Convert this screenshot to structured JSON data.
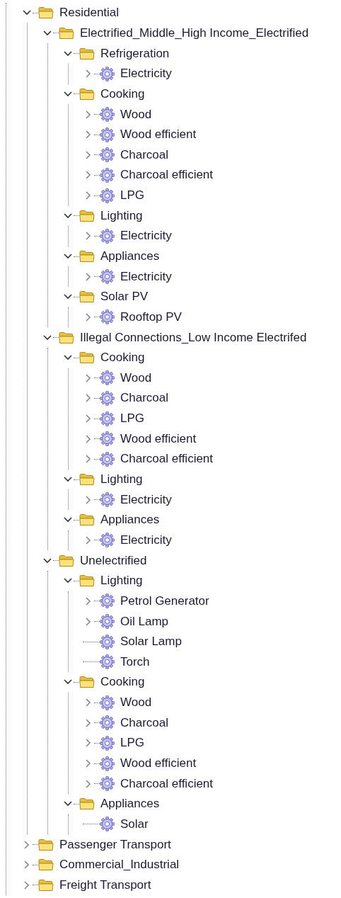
{
  "tree": [
    {
      "label": "Residential",
      "kind": "folder",
      "toggle": true,
      "expanded": true,
      "children": [
        {
          "label": "Electrified_Middle_High Income_Electrified",
          "kind": "folder",
          "toggle": true,
          "expanded": true,
          "children": [
            {
              "label": "Refrigeration",
              "kind": "folder",
              "toggle": true,
              "expanded": true,
              "children": [
                {
                  "label": "Electricity",
                  "kind": "gear",
                  "toggle": true,
                  "expanded": false
                }
              ]
            },
            {
              "label": "Cooking",
              "kind": "folder",
              "toggle": true,
              "expanded": true,
              "children": [
                {
                  "label": "Wood",
                  "kind": "gear",
                  "toggle": true,
                  "expanded": false
                },
                {
                  "label": "Wood efficient",
                  "kind": "gear",
                  "toggle": true,
                  "expanded": false
                },
                {
                  "label": "Charcoal",
                  "kind": "gear",
                  "toggle": true,
                  "expanded": false
                },
                {
                  "label": "Charcoal efficient",
                  "kind": "gear",
                  "toggle": true,
                  "expanded": false
                },
                {
                  "label": "LPG",
                  "kind": "gear",
                  "toggle": true,
                  "expanded": false
                }
              ]
            },
            {
              "label": "Lighting",
              "kind": "folder",
              "toggle": true,
              "expanded": true,
              "children": [
                {
                  "label": "Electricity",
                  "kind": "gear",
                  "toggle": true,
                  "expanded": false
                }
              ]
            },
            {
              "label": "Appliances",
              "kind": "folder",
              "toggle": true,
              "expanded": true,
              "children": [
                {
                  "label": "Electricity",
                  "kind": "gear",
                  "toggle": true,
                  "expanded": false
                }
              ]
            },
            {
              "label": "Solar PV",
              "kind": "folder",
              "toggle": true,
              "expanded": true,
              "children": [
                {
                  "label": "Rooftop PV",
                  "kind": "gear",
                  "toggle": true,
                  "expanded": false
                }
              ]
            }
          ]
        },
        {
          "label": "Illegal Connections_Low Income Electrifed",
          "kind": "folder",
          "toggle": true,
          "expanded": true,
          "children": [
            {
              "label": "Cooking",
              "kind": "folder",
              "toggle": true,
              "expanded": true,
              "children": [
                {
                  "label": "Wood",
                  "kind": "gear",
                  "toggle": true,
                  "expanded": false
                },
                {
                  "label": "Charcoal",
                  "kind": "gear",
                  "toggle": true,
                  "expanded": false
                },
                {
                  "label": "LPG",
                  "kind": "gear",
                  "toggle": true,
                  "expanded": false
                },
                {
                  "label": "Wood efficient",
                  "kind": "gear",
                  "toggle": true,
                  "expanded": false
                },
                {
                  "label": "Charcoal efficient",
                  "kind": "gear",
                  "toggle": true,
                  "expanded": false
                }
              ]
            },
            {
              "label": "Lighting",
              "kind": "folder",
              "toggle": true,
              "expanded": true,
              "children": [
                {
                  "label": "Electricity",
                  "kind": "gear",
                  "toggle": true,
                  "expanded": false
                }
              ]
            },
            {
              "label": "Appliances",
              "kind": "folder",
              "toggle": true,
              "expanded": true,
              "children": [
                {
                  "label": "Electricity",
                  "kind": "gear",
                  "toggle": true,
                  "expanded": false
                }
              ]
            }
          ]
        },
        {
          "label": "Unelectrified",
          "kind": "folder",
          "toggle": true,
          "expanded": true,
          "children": [
            {
              "label": "Lighting",
              "kind": "folder",
              "toggle": true,
              "expanded": true,
              "children": [
                {
                  "label": "Petrol Generator",
                  "kind": "gear",
                  "toggle": true,
                  "expanded": false
                },
                {
                  "label": "Oil Lamp",
                  "kind": "gear",
                  "toggle": true,
                  "expanded": false
                },
                {
                  "label": "Solar Lamp",
                  "kind": "gear",
                  "toggle": false
                },
                {
                  "label": "Torch",
                  "kind": "gear",
                  "toggle": false
                }
              ]
            },
            {
              "label": "Cooking",
              "kind": "folder",
              "toggle": true,
              "expanded": true,
              "children": [
                {
                  "label": "Wood",
                  "kind": "gear",
                  "toggle": true,
                  "expanded": false
                },
                {
                  "label": "Charcoal",
                  "kind": "gear",
                  "toggle": true,
                  "expanded": false
                },
                {
                  "label": "LPG",
                  "kind": "gear",
                  "toggle": true,
                  "expanded": false
                },
                {
                  "label": "Wood efficient",
                  "kind": "gear",
                  "toggle": true,
                  "expanded": false
                },
                {
                  "label": "Charcoal efficient",
                  "kind": "gear",
                  "toggle": true,
                  "expanded": false
                }
              ]
            },
            {
              "label": "Appliances",
              "kind": "folder",
              "toggle": true,
              "expanded": true,
              "children": [
                {
                  "label": "Solar",
                  "kind": "gear",
                  "toggle": false
                }
              ]
            }
          ]
        }
      ]
    },
    {
      "label": "Passenger Transport",
      "kind": "folder",
      "toggle": true,
      "expanded": false
    },
    {
      "label": "Commercial_Industrial",
      "kind": "folder",
      "toggle": true,
      "expanded": false
    },
    {
      "label": "Freight Transport",
      "kind": "folder",
      "toggle": true,
      "expanded": false
    }
  ]
}
